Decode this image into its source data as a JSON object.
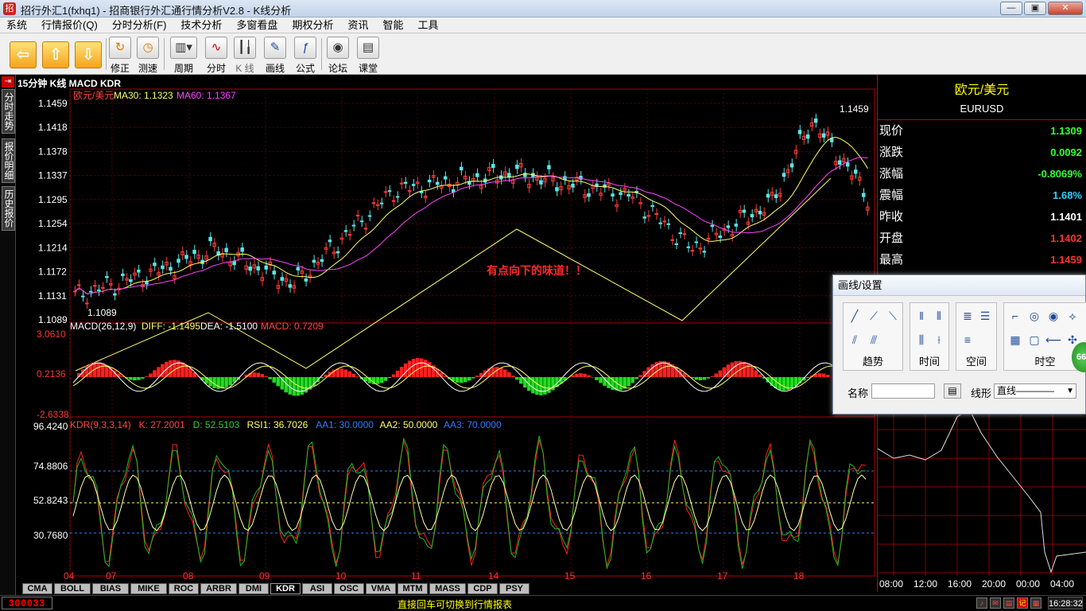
{
  "window": {
    "title": "招行外汇1(fxhq1) - 招商银行外汇通行情分析V2.8 - K线分析",
    "buttons": [
      "minimize",
      "maximize",
      "close"
    ]
  },
  "menu": [
    "系统",
    "行情报价(Q)",
    "分时分析(F)",
    "技术分析",
    "多窗看盘",
    "期权分析",
    "资讯",
    "智能",
    "工具"
  ],
  "toolbar": {
    "nav": [
      "back-arrow",
      "up-arrow",
      "down-arrow"
    ],
    "buttons": [
      {
        "label": "修正",
        "icon": "refresh"
      },
      {
        "label": "测速",
        "icon": "clock"
      },
      {
        "label": "周期",
        "icon": "period"
      },
      {
        "label": "分时",
        "icon": "timeshare"
      },
      {
        "label": "K 线",
        "icon": "kline"
      },
      {
        "label": "画线",
        "icon": "draw"
      },
      {
        "label": "公式",
        "icon": "formula"
      },
      {
        "label": "论坛",
        "icon": "forum"
      },
      {
        "label": "课堂",
        "icon": "classroom"
      }
    ]
  },
  "leftTabs": [
    "分时走势",
    "报价明细",
    "历史报价"
  ],
  "chart": {
    "heading": "15分钟 K线 MACD KDR",
    "main": {
      "symbol": "欧元/美元",
      "ma30Label": "MA30: 1.1323",
      "ma60Label": "MA60: 1.1367",
      "yTicks": [
        "1.1459",
        "1.1418",
        "1.1378",
        "1.1337",
        "1.1295",
        "1.1254",
        "1.1214",
        "1.1172",
        "1.1131",
        "1.1089"
      ],
      "highLabel": "1.1459",
      "lowLabel": "1.1089",
      "annotation": "有点向下的味道！！"
    },
    "macd": {
      "label": "MACD(26,12,9)",
      "diff": "DIFF: -1.1495",
      "dea": "DEA: -1.5100",
      "macd": "MACD: 0.7209",
      "yTicks": [
        "3.0610",
        "0.2136",
        "-2.6338"
      ]
    },
    "kdr": {
      "label": "KDR(9,3,3,14)",
      "k": "K: 27.2001",
      "d": "D: 52.5103",
      "rsi": "RSI1: 36.7026",
      "aa1": "AA1: 30.0000",
      "aa2": "AA2: 50.0000",
      "aa3": "AA3: 70.0000",
      "yTicks": [
        "96.4240",
        "74.8806",
        "52.8243",
        "30.7680"
      ]
    },
    "xTicks": [
      "04",
      "07",
      "08",
      "09",
      "10",
      "11",
      "14",
      "15",
      "16",
      "17",
      "18"
    ]
  },
  "rightPanel": {
    "name": "欧元/美元",
    "code": "EURUSD",
    "rows": [
      {
        "k": "现价",
        "v": "1.1309",
        "c": "#33ff33"
      },
      {
        "k": "涨跌",
        "v": "0.0092",
        "c": "#33ff33"
      },
      {
        "k": "涨幅",
        "v": "-0.8069%",
        "c": "#33ff33"
      },
      {
        "k": "震幅",
        "v": "1.68%",
        "c": "#33ccff"
      },
      {
        "k": "昨收",
        "v": "1.1401",
        "c": "#ffffff"
      },
      {
        "k": "开盘",
        "v": "1.1402",
        "c": "#ff3333"
      },
      {
        "k": "最高",
        "v": "1.1459",
        "c": "#ff3333"
      }
    ],
    "miniXTicks": [
      "08:00",
      "12:00",
      "16:00",
      "20:00",
      "00:00",
      "04:00"
    ]
  },
  "dialog": {
    "title": "画线/设置",
    "groups": [
      "趋势",
      "时间",
      "空间",
      "时空"
    ],
    "nameLabel": "名称",
    "lineTypeLabel": "线形",
    "lineTypeValue": "直线",
    "badge": "66"
  },
  "bottomTabs": [
    "CMA",
    "BOLL",
    "BIAS",
    "MIKE",
    "ROC",
    "ARBR",
    "DMI",
    "KDR",
    "ASI",
    "OSC",
    "VMA",
    "MTM",
    "MASS",
    "CDP",
    "PSY"
  ],
  "activeTab": "KDR",
  "status": {
    "id": "300033",
    "message": "直接回车可切换到行情报表",
    "time": "16:28:32",
    "icons": [
      "sound",
      "mail",
      "note",
      "记",
      "net"
    ]
  }
}
